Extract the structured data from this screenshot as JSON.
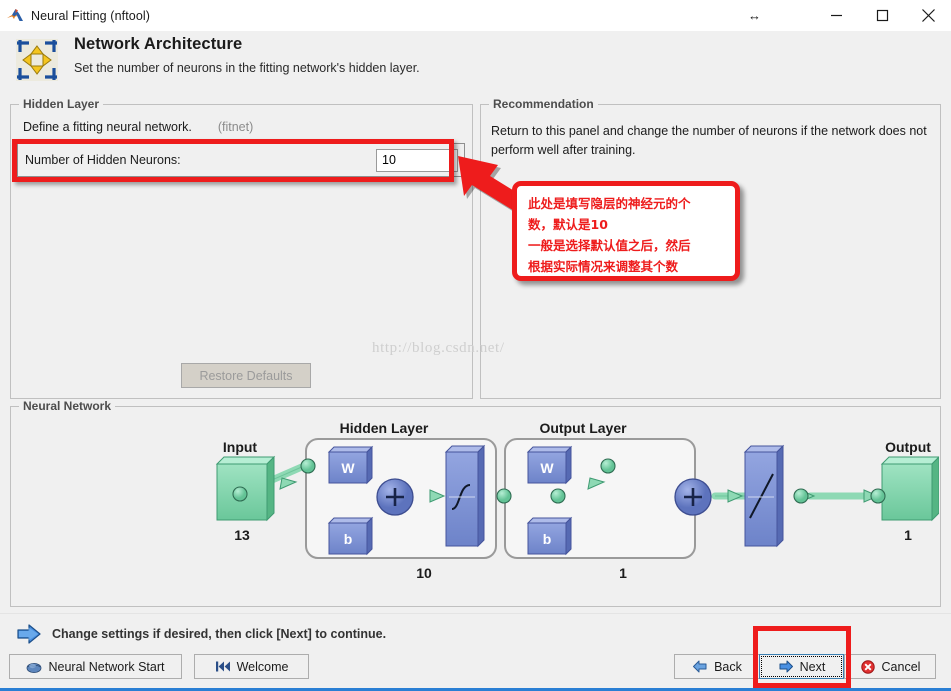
{
  "window": {
    "title": "Neural Fitting (nftool)",
    "app_icon": "matlab-membrane-icon",
    "resize_glyph": "↔",
    "controls": {
      "minimize": "minimize-icon",
      "maximize": "maximize-icon",
      "close": "close-icon"
    }
  },
  "header": {
    "icon": "network-architecture-icon",
    "title": "Network Architecture",
    "subtitle": "Set the number of neurons in the fitting network's hidden layer."
  },
  "hidden_layer": {
    "legend": "Hidden Layer",
    "description": "Define a fitting neural network.",
    "function_hint": "(fitnet)",
    "field_label": "Number of Hidden Neurons:",
    "field_value": "10",
    "restore_button": "Restore Defaults"
  },
  "recommendation": {
    "legend": "Recommendation",
    "text": "Return to this panel and change the number of neurons if the network does not perform well after training."
  },
  "annotations": {
    "callout_text": "此处是填写隐层的神经元的个\n数，默认是10\n一般是选择默认值之后，然后\n根据实际情况来调整其个数",
    "callout_color": "#ee1c1c",
    "highlight_color": "#ee1c1c"
  },
  "watermark": "http://blog.csdn.net/",
  "neural_network": {
    "legend": "Neural Network",
    "input_label": "Input",
    "input_size": "13",
    "hidden_layer_label": "Hidden Layer",
    "hidden_layer_size": "10",
    "output_layer_label": "Output Layer",
    "output_layer_size": "1",
    "output_label": "Output",
    "output_size": "1",
    "weight_symbol": "W",
    "bias_symbol": "b",
    "sum_symbol": "+",
    "hidden_transfer": "sigmoid-icon",
    "output_transfer": "linear-icon",
    "colors": {
      "block_green": "#7fd7ad",
      "block_blue": "#7f93d5",
      "connector_green": "#8fd9b6"
    }
  },
  "status": {
    "icon": "blue-right-arrow-icon",
    "text": "Change settings  if desired, then click [Next] to continue."
  },
  "buttons": {
    "neural_network_start": "Neural Network Start",
    "neural_network_start_icon": "brain-icon",
    "welcome": "Welcome",
    "welcome_icon": "skip-back-icon",
    "back": "Back",
    "back_icon": "left-arrow-icon",
    "next": "Next",
    "next_icon": "right-arrow-icon",
    "cancel": "Cancel",
    "cancel_icon": "cancel-circle-icon"
  }
}
